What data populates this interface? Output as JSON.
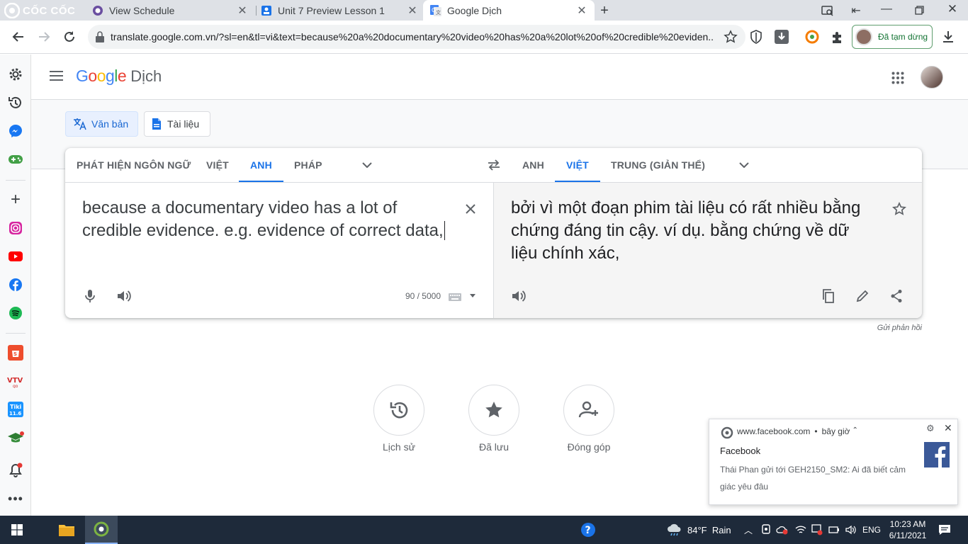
{
  "browser": {
    "brand": "CỐC CỐC",
    "tabs": [
      {
        "title": "View Schedule",
        "active": false
      },
      {
        "title": "Unit 7 Preview Lesson 1",
        "active": false
      },
      {
        "title": "Google Dịch",
        "active": true
      }
    ],
    "url": "translate.google.com.vn/?sl=en&tl=vi&text=because%20a%20documentary%20video%20has%20a%20lot%20of%20credible%20eviden...",
    "paused_label": "Đã tạm dừng"
  },
  "page": {
    "logo_google": "Google",
    "logo_product": "Dịch",
    "modes": {
      "text": "Văn bản",
      "document": "Tài liệu"
    },
    "source_langs": [
      "PHÁT HIỆN NGÔN NGỮ",
      "VIỆT",
      "ANH",
      "PHÁP"
    ],
    "source_selected": "ANH",
    "target_langs": [
      "ANH",
      "VIỆT",
      "TRUNG (GIẢN THỂ)"
    ],
    "target_selected": "VIỆT",
    "source_text": "because a documentary video has a lot of credible evidence. e.g. evidence of correct data,",
    "char_count": "90 / 5000",
    "translation": "bởi vì một đoạn phim tài liệu có rất nhiều bằng chứng đáng tin cậy. ví dụ. bằng chứng về dữ liệu chính xác,",
    "feedback": "Gửi phản hồi",
    "bottom_actions": [
      "Lịch sử",
      "Đã lưu",
      "Đóng góp"
    ]
  },
  "notification": {
    "site": "www.facebook.com",
    "time": "bây giờ",
    "title": "Facebook",
    "body": "Thái Phan gửi tới GEH2150_SM2: Ai đã biết cảm giác yêu đâu"
  },
  "taskbar": {
    "weather": "84°F  Rain",
    "lang": "ENG",
    "time": "10:23 AM",
    "date": "6/11/2021"
  },
  "colors": {
    "accent": "#1a73e8",
    "taskbar": "#1e2a3a",
    "tabstrip": "#dee1e6",
    "coccoc": "#7cb342"
  }
}
